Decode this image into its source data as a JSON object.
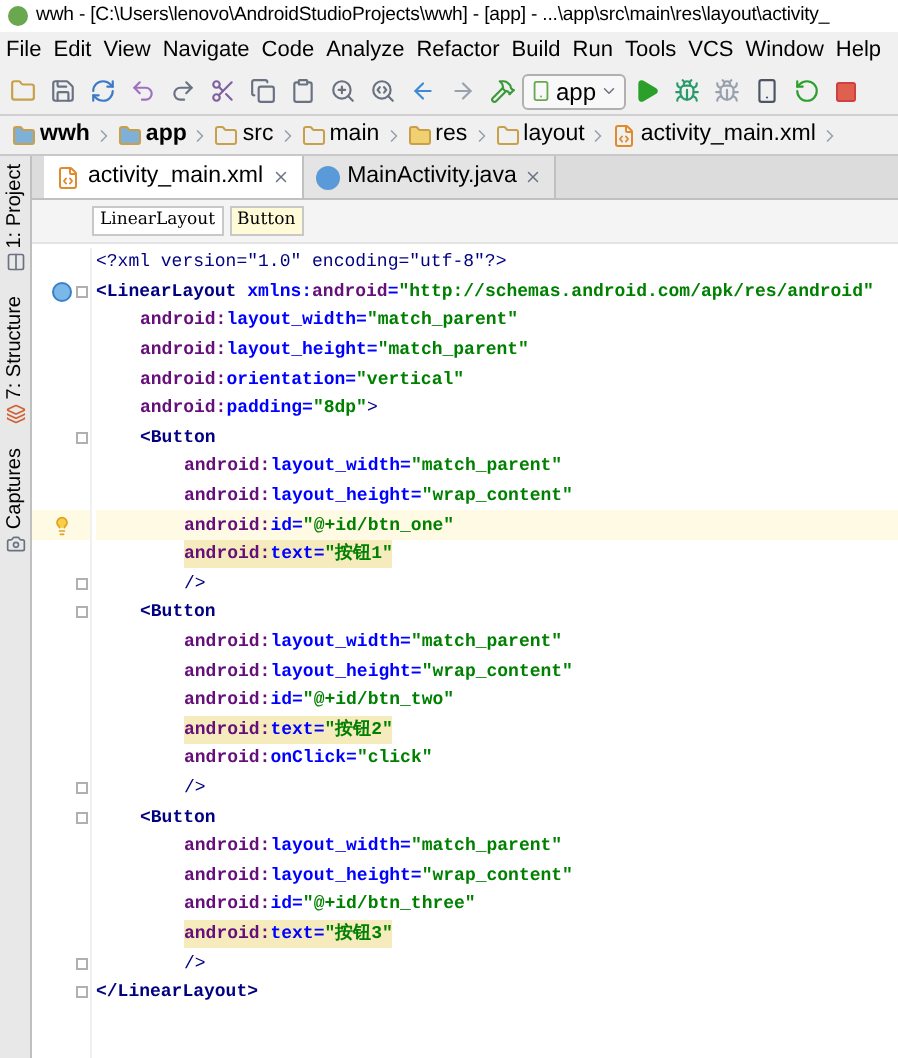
{
  "window": {
    "title": "wwh - [C:\\Users\\lenovo\\AndroidStudioProjects\\wwh] - [app] - ...\\app\\src\\main\\res\\layout\\activity_"
  },
  "menu": [
    "File",
    "Edit",
    "View",
    "Navigate",
    "Code",
    "Analyze",
    "Refactor",
    "Build",
    "Run",
    "Tools",
    "VCS",
    "Window",
    "Help"
  ],
  "toolbar": {
    "run_config": "app"
  },
  "breadcrumbs": [
    {
      "label": "wwh",
      "kind": "module"
    },
    {
      "label": "app",
      "kind": "module"
    },
    {
      "label": "src",
      "kind": "folder"
    },
    {
      "label": "main",
      "kind": "folder"
    },
    {
      "label": "res",
      "kind": "res"
    },
    {
      "label": "layout",
      "kind": "folder"
    },
    {
      "label": "activity_main.xml",
      "kind": "xml"
    }
  ],
  "side_tools": [
    {
      "label": "1: Project",
      "kind": "project"
    },
    {
      "label": "7: Structure",
      "kind": "structure"
    },
    {
      "label": "Captures",
      "kind": "captures"
    }
  ],
  "tabs": [
    {
      "label": "activity_main.xml",
      "kind": "xml",
      "selected": true
    },
    {
      "label": "MainActivity.java",
      "kind": "class",
      "selected": false
    }
  ],
  "tag_path": [
    {
      "label": "LinearLayout",
      "selected": false
    },
    {
      "label": "Button",
      "selected": true
    }
  ],
  "code": [
    {
      "kind": "plain",
      "tokens": [
        {
          "kind": "punct",
          "text": "<?xml version=\"1.0\" encoding=\"utf-8\"?>"
        }
      ]
    },
    {
      "kind": "class",
      "fold": true,
      "tokens": [
        {
          "kind": "tag",
          "text": "<LinearLayout "
        },
        {
          "kind": "name",
          "text": "xmlns:"
        },
        {
          "kind": "ns",
          "text": "android"
        },
        {
          "kind": "name",
          "text": "="
        },
        {
          "kind": "value",
          "text": "\"http://schemas.android.com/apk/res/android\""
        }
      ],
      "children": [
        {
          "kind": "plain",
          "tokens": [
            {
              "kind": "ns",
              "text": "android:"
            },
            {
              "kind": "name",
              "text": "layout_width="
            },
            {
              "kind": "value",
              "text": "\"match_parent\""
            }
          ]
        },
        {
          "kind": "plain",
          "tokens": [
            {
              "kind": "ns",
              "text": "android:"
            },
            {
              "kind": "name",
              "text": "layout_height="
            },
            {
              "kind": "value",
              "text": "\"match_parent\""
            }
          ]
        },
        {
          "kind": "plain",
          "tokens": [
            {
              "kind": "ns",
              "text": "android:"
            },
            {
              "kind": "name",
              "text": "orientation="
            },
            {
              "kind": "value",
              "text": "\"vertical\""
            }
          ]
        },
        {
          "kind": "plain",
          "tokens": [
            {
              "kind": "ns",
              "text": "android:"
            },
            {
              "kind": "name",
              "text": "padding="
            },
            {
              "kind": "value",
              "text": "\"8dp\""
            },
            {
              "kind": "punct",
              "text": ">"
            }
          ]
        },
        {
          "kind": "plain",
          "fold": true,
          "tokens": [
            {
              "kind": "tag",
              "text": "<Button"
            }
          ],
          "children": [
            {
              "kind": "plain",
              "tokens": [
                {
                  "kind": "ns",
                  "text": "android:"
                },
                {
                  "kind": "name",
                  "text": "layout_width="
                },
                {
                  "kind": "value",
                  "text": "\"match_parent\""
                }
              ]
            },
            {
              "kind": "plain",
              "tokens": [
                {
                  "kind": "ns",
                  "text": "android:"
                },
                {
                  "kind": "name",
                  "text": "layout_height="
                },
                {
                  "kind": "value",
                  "text": "\"wrap_content\""
                }
              ]
            },
            {
              "kind": "bulb",
              "current": true,
              "tokens": [
                {
                  "kind": "ns",
                  "text": "android:"
                },
                {
                  "kind": "name",
                  "text": "id="
                },
                {
                  "kind": "value",
                  "text": "\"@+id/btn_one\""
                }
              ]
            },
            {
              "kind": "plain",
              "highlight": true,
              "tokens": [
                {
                  "kind": "ns",
                  "text": "android:"
                },
                {
                  "kind": "name",
                  "text": "text="
                },
                {
                  "kind": "value",
                  "text": "\"按钮1\""
                }
              ]
            },
            {
              "kind": "plain",
              "fold": true,
              "tokens": [
                {
                  "kind": "punct",
                  "text": "/>"
                }
              ]
            }
          ]
        },
        {
          "kind": "plain",
          "fold": true,
          "tokens": [
            {
              "kind": "tag",
              "text": "<Button"
            }
          ],
          "children": [
            {
              "kind": "plain",
              "tokens": [
                {
                  "kind": "ns",
                  "text": "android:"
                },
                {
                  "kind": "name",
                  "text": "layout_width="
                },
                {
                  "kind": "value",
                  "text": "\"match_parent\""
                }
              ]
            },
            {
              "kind": "plain",
              "tokens": [
                {
                  "kind": "ns",
                  "text": "android:"
                },
                {
                  "kind": "name",
                  "text": "layout_height="
                },
                {
                  "kind": "value",
                  "text": "\"wrap_content\""
                }
              ]
            },
            {
              "kind": "plain",
              "tokens": [
                {
                  "kind": "ns",
                  "text": "android:"
                },
                {
                  "kind": "name",
                  "text": "id="
                },
                {
                  "kind": "value",
                  "text": "\"@+id/btn_two\""
                }
              ]
            },
            {
              "kind": "plain",
              "highlight": true,
              "tokens": [
                {
                  "kind": "ns",
                  "text": "android:"
                },
                {
                  "kind": "name",
                  "text": "text="
                },
                {
                  "kind": "value",
                  "text": "\"按钮2\""
                }
              ]
            },
            {
              "kind": "plain",
              "tokens": [
                {
                  "kind": "ns",
                  "text": "android:"
                },
                {
                  "kind": "name",
                  "text": "onClick="
                },
                {
                  "kind": "value",
                  "text": "\"click\""
                }
              ]
            },
            {
              "kind": "plain",
              "fold": true,
              "tokens": [
                {
                  "kind": "punct",
                  "text": "/>"
                }
              ]
            }
          ]
        },
        {
          "kind": "plain",
          "fold": true,
          "tokens": [
            {
              "kind": "tag",
              "text": "<Button"
            }
          ],
          "children": [
            {
              "kind": "plain",
              "tokens": [
                {
                  "kind": "ns",
                  "text": "android:"
                },
                {
                  "kind": "name",
                  "text": "layout_width="
                },
                {
                  "kind": "value",
                  "text": "\"match_parent\""
                }
              ]
            },
            {
              "kind": "plain",
              "tokens": [
                {
                  "kind": "ns",
                  "text": "android:"
                },
                {
                  "kind": "name",
                  "text": "layout_height="
                },
                {
                  "kind": "value",
                  "text": "\"wrap_content\""
                }
              ]
            },
            {
              "kind": "plain",
              "tokens": [
                {
                  "kind": "ns",
                  "text": "android:"
                },
                {
                  "kind": "name",
                  "text": "id="
                },
                {
                  "kind": "value",
                  "text": "\"@+id/btn_three\""
                }
              ]
            },
            {
              "kind": "plain",
              "highlight": true,
              "tokens": [
                {
                  "kind": "ns",
                  "text": "android:"
                },
                {
                  "kind": "name",
                  "text": "text="
                },
                {
                  "kind": "value",
                  "text": "\"按钮3\""
                }
              ]
            },
            {
              "kind": "plain",
              "fold": true,
              "tokens": [
                {
                  "kind": "punct",
                  "text": "/>"
                }
              ]
            }
          ]
        }
      ]
    },
    {
      "kind": "plain",
      "fold": true,
      "tokens": [
        {
          "kind": "tag",
          "text": "</LinearLayout>"
        }
      ]
    }
  ]
}
